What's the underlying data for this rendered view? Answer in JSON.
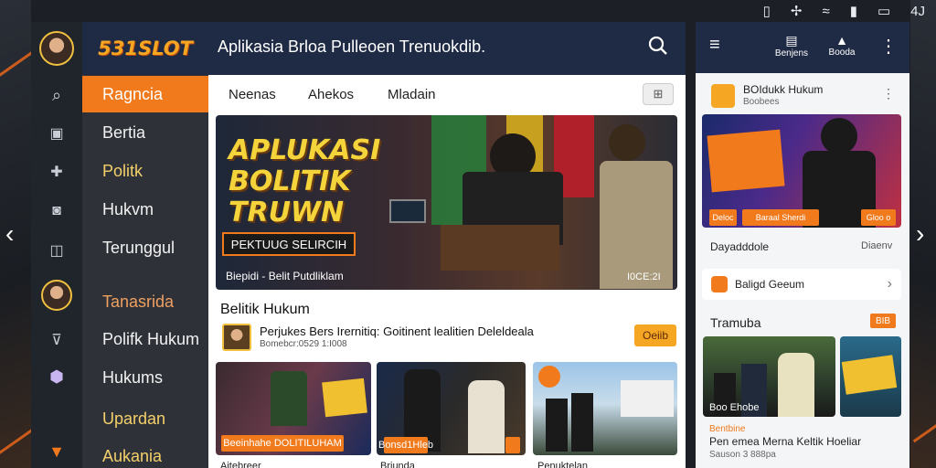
{
  "status_bar": {
    "icons": [
      "sim-icon",
      "share-icon",
      "wifi-icon",
      "battery-icon",
      "screen-icon"
    ],
    "label": "4J"
  },
  "brand": {
    "name": "531SLOT"
  },
  "search": {
    "placeholder": "Aplikasia Brloa Pulleoen Trenuokdib."
  },
  "left_nav": {
    "items": [
      {
        "label": "Ragncia",
        "active": true
      },
      {
        "label": "Bertia"
      },
      {
        "label": "Politk"
      },
      {
        "label": "Hukvm"
      },
      {
        "label": "Terunggul"
      },
      {
        "label": "Tanasrida"
      },
      {
        "label": "Polifk Hukum"
      },
      {
        "label": "Hukums"
      },
      {
        "label": "Upardan"
      },
      {
        "label": "Aukania"
      }
    ]
  },
  "tabs": [
    "Neenas",
    "Ahekos",
    "Mladain"
  ],
  "hero": {
    "headline_line1": "APLUKASI",
    "headline_line2": "BOLITIK",
    "headline_line3": "TRUWN",
    "banner": "PEKTUUG SELIRCIH",
    "caption": "Biepidi - Belit Putdliklam",
    "counter": "I0CE:2I"
  },
  "section": {
    "title": "Belitik Hukum",
    "article_title": "Perjukes Bers Irernitiq: Goitinent lealitien Deleldeala",
    "article_meta": "Bomebcr:0529 1:I008",
    "article_badge": "Oeiib"
  },
  "cards": [
    {
      "label": "Beeinhahe DOLITILUHAM",
      "caption": "Aitebreer"
    },
    {
      "label": "Bonsd1Hleb",
      "caption": "Briunda"
    },
    {
      "label": "",
      "caption": "Penuktelan"
    }
  ],
  "right_panel": {
    "top_icons": [
      {
        "name": "menu-icon",
        "label": ""
      },
      {
        "name": "bookmark-icon",
        "label": "Benjens"
      },
      {
        "name": "user-icon",
        "label": "Booda"
      },
      {
        "name": "more-icon",
        "label": ""
      }
    ],
    "app_name": "BOIdukk Hukum",
    "app_sub": "Boobees",
    "card_labels": [
      "Deloc",
      "Baraal Sherdi",
      "Gloo o"
    ],
    "meta_left": "Dayadddole",
    "meta_right": "Diaenv",
    "row_label": "Baligd Geeum",
    "section_title": "Tramuba",
    "section_badge": "BIB",
    "story_label": "Bentbine",
    "story_title": "Pen emea Merna Keltik Hoeliar",
    "story_meta": "Sauson 3 888pa",
    "story_caption": "Boo Ehobe"
  }
}
